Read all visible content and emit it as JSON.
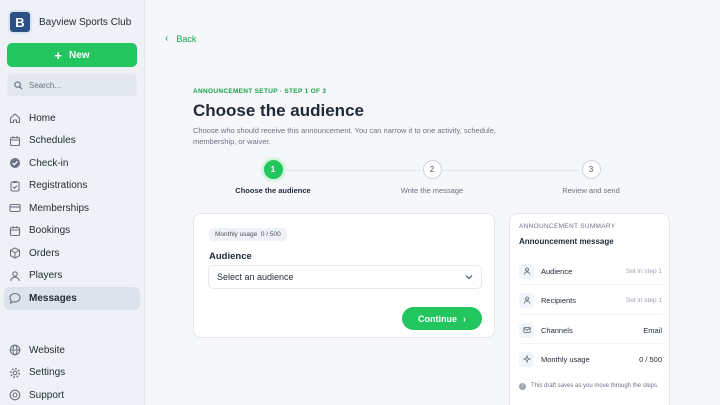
{
  "brand": {
    "logo_letter": "B",
    "name": "Bayview Sports Club"
  },
  "sidebar": {
    "new_label": "New",
    "search_placeholder": "Search...",
    "items": [
      {
        "label": "Home",
        "icon": "home-icon"
      },
      {
        "label": "Schedules",
        "icon": "calendar-icon"
      },
      {
        "label": "Check-in",
        "icon": "check-circle-icon"
      },
      {
        "label": "Registrations",
        "icon": "clipboard-check-icon"
      },
      {
        "label": "Memberships",
        "icon": "card-icon"
      },
      {
        "label": "Bookings",
        "icon": "calendar-icon"
      },
      {
        "label": "Orders",
        "icon": "box-icon"
      },
      {
        "label": "Players",
        "icon": "users-icon"
      },
      {
        "label": "Messages",
        "icon": "chat-icon",
        "active": true
      }
    ],
    "bottom_items": [
      {
        "label": "Website",
        "icon": "globe-icon"
      },
      {
        "label": "Settings",
        "icon": "gear-icon"
      },
      {
        "label": "Support",
        "icon": "help-icon"
      }
    ]
  },
  "main": {
    "back_label": "Back",
    "eyebrow": "ANNOUNCEMENT SETUP · STEP 1 OF 3",
    "title": "Choose the audience",
    "subtitle": "Choose who should receive this announcement. You can narrow it to one activity, schedule, membership, or waiver.",
    "steps": [
      {
        "number": "1",
        "label": "Choose the audience",
        "active": true
      },
      {
        "number": "2",
        "label": "Write the message",
        "active": false
      },
      {
        "number": "3",
        "label": "Review and send",
        "active": false
      }
    ],
    "form": {
      "usage_pill": "Monthly usage  0 / 500",
      "audience_label": "Audience",
      "audience_placeholder": "Select an audience",
      "continue_label": "Continue"
    }
  },
  "summary": {
    "eyebrow": "ANNOUNCEMENT SUMMARY",
    "title": "Announcement message",
    "rows": [
      {
        "label": "Audience",
        "value": "Set in step 1",
        "strong": false,
        "icon": "users-icon"
      },
      {
        "label": "Recipients",
        "value": "Set in step 1",
        "strong": false,
        "icon": "users-icon"
      },
      {
        "label": "Channels",
        "value": "Email",
        "strong": true,
        "icon": "mail-icon"
      },
      {
        "label": "Monthly usage",
        "value": "0 / 500",
        "strong": true,
        "icon": "sparkle-icon"
      }
    ],
    "note": "This draft saves as you move through the steps."
  },
  "colors": {
    "accent": "#22c55e",
    "brand": "#2c4f86"
  }
}
